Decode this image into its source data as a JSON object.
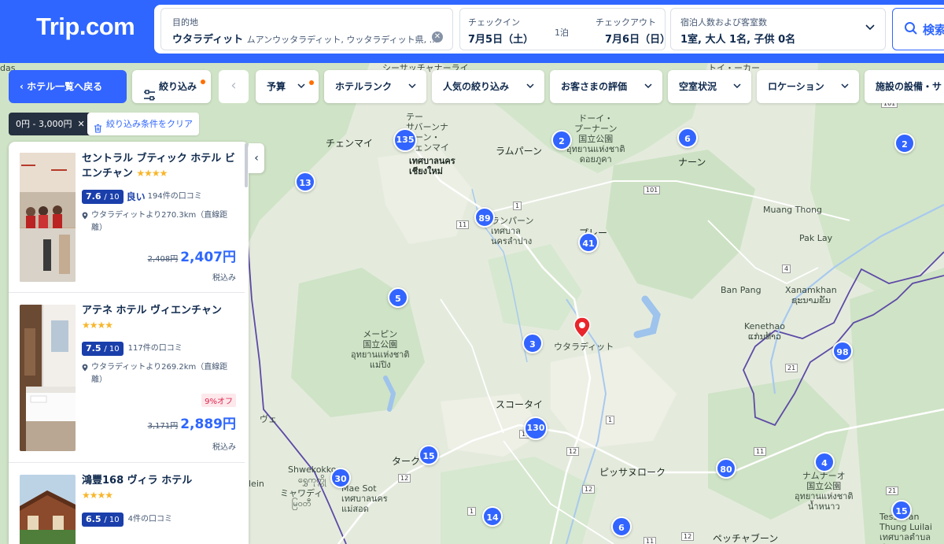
{
  "header": {
    "logo": "Trip.com",
    "destination": {
      "label": "目的地",
      "value": "ウタラディット",
      "sub": "ムアンウッタラディット, ウッタラディット県, ..."
    },
    "checkin": {
      "label": "チェックイン",
      "value": "7月5日（土）"
    },
    "nights": "1泊",
    "checkout": {
      "label": "チェックアウト",
      "value": "7月6日（日）"
    },
    "guests": {
      "label": "宿泊人数および客室数",
      "value": "1室, 大人 1名, 子供 0名"
    },
    "search_label": "検索"
  },
  "filters": {
    "back": "ホテル一覧へ戻る",
    "filter": "絞り込み",
    "chips": [
      "予算",
      "ホテルランク",
      "人気の絞り込み",
      "お客さまの評価",
      "空室状況",
      "ロケーション",
      "施設の設備・サ"
    ],
    "active_tag": "0円 - 3,000円",
    "clear": "絞り込み条件をクリア"
  },
  "hotels": [
    {
      "name": "セントラル ブティック ホテル ビエンチャン",
      "stars": "★★★★",
      "score": "7.6",
      "score_max": "/ 10",
      "score_word": "良い",
      "reviews": "194件の口コミ",
      "distance": "ウタラディットより270.3km（直線距離）",
      "old_price": "2,408円",
      "price": "2,407円",
      "tax": "税込み"
    },
    {
      "name": "アテネ ホテル ヴィエンチャン",
      "stars": "★★★★",
      "score": "7.5",
      "score_max": "/ 10",
      "reviews": "117件の口コミ",
      "distance": "ウタラディットより269.2km（直線距離）",
      "discount": "9%オフ",
      "old_price": "3,171円",
      "price": "2,889円",
      "tax": "税込み"
    },
    {
      "name": "鴻豐168 ヴィラ ホテル",
      "stars": "★★★★",
      "score": "6.5",
      "score_max": "/ 10",
      "reviews": "4件の口コミ"
    }
  ],
  "map": {
    "places": [
      {
        "id": "chiangmai-ja",
        "text": "チェンマイ"
      },
      {
        "id": "chiangmai-tes",
        "text": "テー\nサバーンナ\nコーン・\nチェンマイ"
      },
      {
        "id": "chiangmai-th",
        "text": "เทศบาลนคร\nเชียงใหม่"
      },
      {
        "id": "lamphun",
        "text": "ラムパーン"
      },
      {
        "id": "doi-phu",
        "text": "ドーイ・\nプーナーン\n国立公園\nอุทยานแห่งชาติ\nดอยภูคา"
      },
      {
        "id": "nan",
        "text": "ナーン"
      },
      {
        "id": "lampang",
        "text": "ランパーン\nเทศบาล\nนครลำปาง"
      },
      {
        "id": "muang-thong",
        "text": "Muang Thong"
      },
      {
        "id": "pak-lay",
        "text": "Pak Lay"
      },
      {
        "id": "phrae",
        "text": "プレー"
      },
      {
        "id": "ban-pang",
        "text": "Ban Pang"
      },
      {
        "id": "xanamkhan",
        "text": "Xanamkhan\nຊະນາມຂັນ"
      },
      {
        "id": "kenethao",
        "text": "Kenethao\nແກ່ນທ້າວ"
      },
      {
        "id": "mae-ping",
        "text": "メーピン\n国立公園\nอุทยานแห่งชาติ\nแม่ปิง"
      },
      {
        "id": "uttaradit",
        "text": "ウタラディット"
      },
      {
        "id": "sukhothai",
        "text": "スコータイ"
      },
      {
        "id": "tak",
        "text": "ターク"
      },
      {
        "id": "phitsanulok",
        "text": "ピッサヌローク"
      },
      {
        "id": "shwekokko",
        "text": "Shwekokko\nရွှေကုက္ကို"
      },
      {
        "id": "mae-sot",
        "text": "Mae Sot\nเทศบาลนคร\nแม่สอด"
      },
      {
        "id": "myawaddy",
        "text": "ミャワディ\nမြဝတီ"
      },
      {
        "id": "nam-nao",
        "text": "ナムナーオ\n国立公園\nอุทยานแห่งชาติ\nน้ำหนาว"
      },
      {
        "id": "tessaban",
        "text": "Tessaban\nThung Luilai\nเทศบาลตำบล\nทุ่งลุยลาย"
      },
      {
        "id": "phetchabun",
        "text": "ペッチャブーン"
      },
      {
        "id": "srisat",
        "text": "シーサッチャナーライ"
      },
      {
        "id": "doi-khao",
        "text": "トイ・ーカー"
      },
      {
        "id": "wo",
        "text": "ヴェ"
      },
      {
        "id": "lein",
        "text": "lein"
      },
      {
        "id": "das",
        "text": "das"
      }
    ],
    "roads": [
      "1",
      "11",
      "101",
      "11",
      "1",
      "101",
      "12",
      "12",
      "12",
      "11",
      "21",
      "21",
      "12",
      "1",
      "11",
      "4"
    ],
    "clusters": [
      "135",
      "2",
      "6",
      "2",
      "13",
      "89",
      "41",
      "5",
      "3",
      "98",
      "130",
      "15",
      "30",
      "80",
      "4",
      "14",
      "6",
      "15"
    ]
  }
}
